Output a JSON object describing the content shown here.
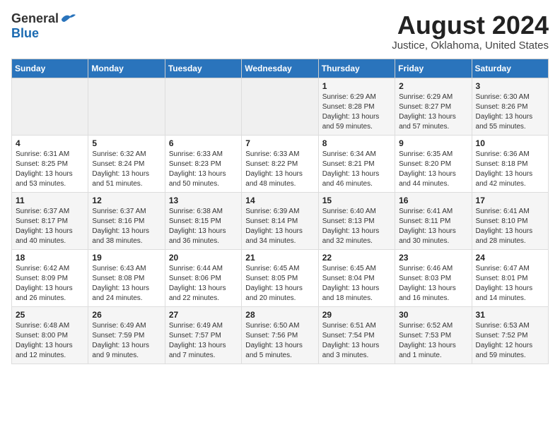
{
  "header": {
    "logo_general": "General",
    "logo_blue": "Blue",
    "month_year": "August 2024",
    "location": "Justice, Oklahoma, United States"
  },
  "days_of_week": [
    "Sunday",
    "Monday",
    "Tuesday",
    "Wednesday",
    "Thursday",
    "Friday",
    "Saturday"
  ],
  "weeks": [
    [
      {
        "day": "",
        "content": ""
      },
      {
        "day": "",
        "content": ""
      },
      {
        "day": "",
        "content": ""
      },
      {
        "day": "",
        "content": ""
      },
      {
        "day": "1",
        "content": "Sunrise: 6:29 AM\nSunset: 8:28 PM\nDaylight: 13 hours\nand 59 minutes."
      },
      {
        "day": "2",
        "content": "Sunrise: 6:29 AM\nSunset: 8:27 PM\nDaylight: 13 hours\nand 57 minutes."
      },
      {
        "day": "3",
        "content": "Sunrise: 6:30 AM\nSunset: 8:26 PM\nDaylight: 13 hours\nand 55 minutes."
      }
    ],
    [
      {
        "day": "4",
        "content": "Sunrise: 6:31 AM\nSunset: 8:25 PM\nDaylight: 13 hours\nand 53 minutes."
      },
      {
        "day": "5",
        "content": "Sunrise: 6:32 AM\nSunset: 8:24 PM\nDaylight: 13 hours\nand 51 minutes."
      },
      {
        "day": "6",
        "content": "Sunrise: 6:33 AM\nSunset: 8:23 PM\nDaylight: 13 hours\nand 50 minutes."
      },
      {
        "day": "7",
        "content": "Sunrise: 6:33 AM\nSunset: 8:22 PM\nDaylight: 13 hours\nand 48 minutes."
      },
      {
        "day": "8",
        "content": "Sunrise: 6:34 AM\nSunset: 8:21 PM\nDaylight: 13 hours\nand 46 minutes."
      },
      {
        "day": "9",
        "content": "Sunrise: 6:35 AM\nSunset: 8:20 PM\nDaylight: 13 hours\nand 44 minutes."
      },
      {
        "day": "10",
        "content": "Sunrise: 6:36 AM\nSunset: 8:18 PM\nDaylight: 13 hours\nand 42 minutes."
      }
    ],
    [
      {
        "day": "11",
        "content": "Sunrise: 6:37 AM\nSunset: 8:17 PM\nDaylight: 13 hours\nand 40 minutes."
      },
      {
        "day": "12",
        "content": "Sunrise: 6:37 AM\nSunset: 8:16 PM\nDaylight: 13 hours\nand 38 minutes."
      },
      {
        "day": "13",
        "content": "Sunrise: 6:38 AM\nSunset: 8:15 PM\nDaylight: 13 hours\nand 36 minutes."
      },
      {
        "day": "14",
        "content": "Sunrise: 6:39 AM\nSunset: 8:14 PM\nDaylight: 13 hours\nand 34 minutes."
      },
      {
        "day": "15",
        "content": "Sunrise: 6:40 AM\nSunset: 8:13 PM\nDaylight: 13 hours\nand 32 minutes."
      },
      {
        "day": "16",
        "content": "Sunrise: 6:41 AM\nSunset: 8:11 PM\nDaylight: 13 hours\nand 30 minutes."
      },
      {
        "day": "17",
        "content": "Sunrise: 6:41 AM\nSunset: 8:10 PM\nDaylight: 13 hours\nand 28 minutes."
      }
    ],
    [
      {
        "day": "18",
        "content": "Sunrise: 6:42 AM\nSunset: 8:09 PM\nDaylight: 13 hours\nand 26 minutes."
      },
      {
        "day": "19",
        "content": "Sunrise: 6:43 AM\nSunset: 8:08 PM\nDaylight: 13 hours\nand 24 minutes."
      },
      {
        "day": "20",
        "content": "Sunrise: 6:44 AM\nSunset: 8:06 PM\nDaylight: 13 hours\nand 22 minutes."
      },
      {
        "day": "21",
        "content": "Sunrise: 6:45 AM\nSunset: 8:05 PM\nDaylight: 13 hours\nand 20 minutes."
      },
      {
        "day": "22",
        "content": "Sunrise: 6:45 AM\nSunset: 8:04 PM\nDaylight: 13 hours\nand 18 minutes."
      },
      {
        "day": "23",
        "content": "Sunrise: 6:46 AM\nSunset: 8:03 PM\nDaylight: 13 hours\nand 16 minutes."
      },
      {
        "day": "24",
        "content": "Sunrise: 6:47 AM\nSunset: 8:01 PM\nDaylight: 13 hours\nand 14 minutes."
      }
    ],
    [
      {
        "day": "25",
        "content": "Sunrise: 6:48 AM\nSunset: 8:00 PM\nDaylight: 13 hours\nand 12 minutes."
      },
      {
        "day": "26",
        "content": "Sunrise: 6:49 AM\nSunset: 7:59 PM\nDaylight: 13 hours\nand 9 minutes."
      },
      {
        "day": "27",
        "content": "Sunrise: 6:49 AM\nSunset: 7:57 PM\nDaylight: 13 hours\nand 7 minutes."
      },
      {
        "day": "28",
        "content": "Sunrise: 6:50 AM\nSunset: 7:56 PM\nDaylight: 13 hours\nand 5 minutes."
      },
      {
        "day": "29",
        "content": "Sunrise: 6:51 AM\nSunset: 7:54 PM\nDaylight: 13 hours\nand 3 minutes."
      },
      {
        "day": "30",
        "content": "Sunrise: 6:52 AM\nSunset: 7:53 PM\nDaylight: 13 hours\nand 1 minute."
      },
      {
        "day": "31",
        "content": "Sunrise: 6:53 AM\nSunset: 7:52 PM\nDaylight: 12 hours\nand 59 minutes."
      }
    ]
  ]
}
